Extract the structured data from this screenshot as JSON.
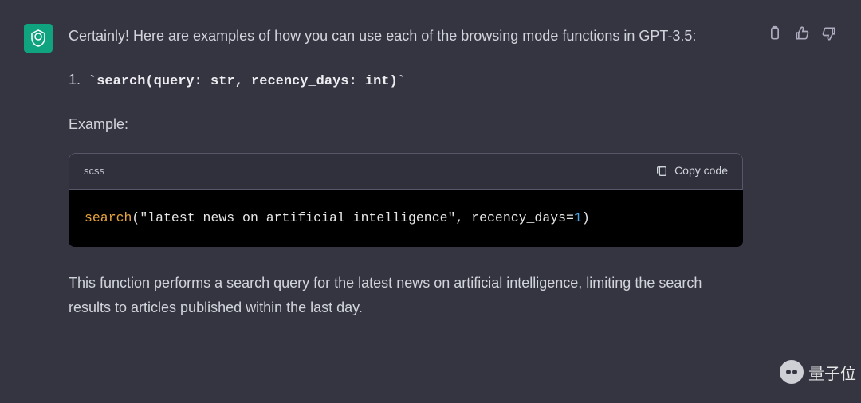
{
  "message": {
    "intro": "Certainly! Here are examples of how you can use each of the browsing mode functions in GPT-3.5:",
    "list_number": "1.",
    "signature": "`search(query: str, recency_days: int)`",
    "example_label": "Example:",
    "code": {
      "lang": "scss",
      "copy_label": "Copy code",
      "fn": "search",
      "open": "(",
      "string": "\"latest news on artificial intelligence\"",
      "comma": ", ",
      "param": "recency_days=",
      "num": "1",
      "close": ")"
    },
    "description": "This function performs a search query for the latest news on artificial intelligence, limiting the search results to articles published within the last day."
  },
  "watermark": "量子位"
}
